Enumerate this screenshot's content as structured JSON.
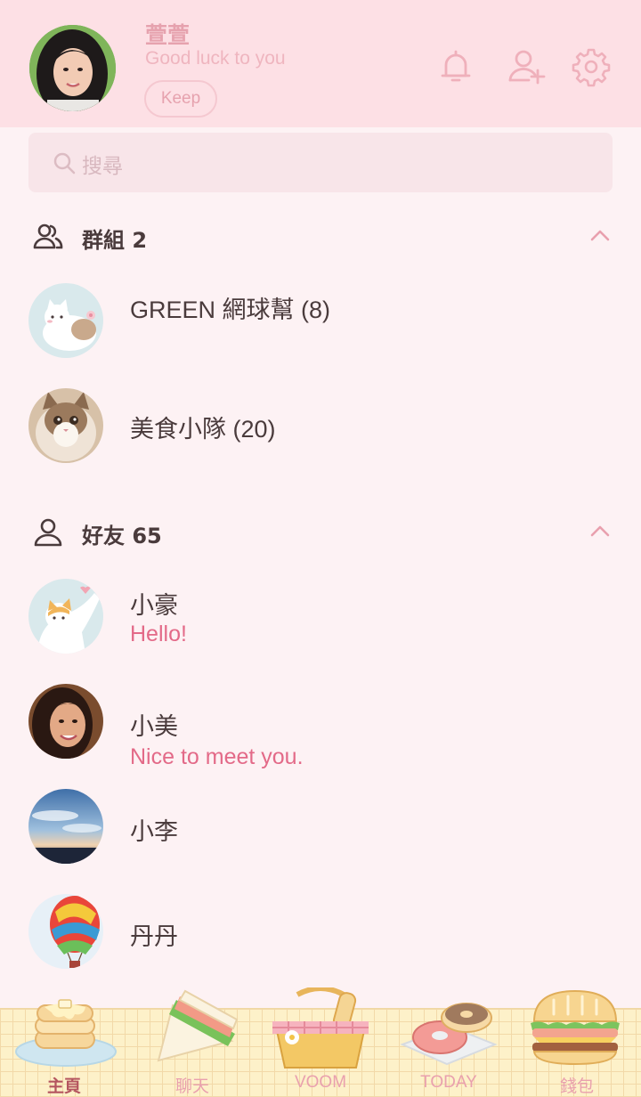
{
  "profile": {
    "name": "萱萱",
    "status": "Good luck to you",
    "keep_label": "Keep"
  },
  "header_icons": [
    "bell-icon",
    "add-friend-icon",
    "settings-gear-icon"
  ],
  "search": {
    "placeholder": "搜尋"
  },
  "groups": {
    "title": "群組 2",
    "items": [
      {
        "name": "GREEN 網球幫 (8)"
      },
      {
        "name": "美食小隊 (20)"
      }
    ]
  },
  "friends": {
    "title": "好友 65",
    "items": [
      {
        "name": "小豪",
        "message": "Hello!"
      },
      {
        "name": "小美",
        "message": "Nice to meet you."
      },
      {
        "name": "小李",
        "message": ""
      },
      {
        "name": "丹丹",
        "message": ""
      }
    ]
  },
  "tabs": [
    {
      "label": "主頁",
      "icon": "pancake-icon",
      "active": true
    },
    {
      "label": "聊天",
      "icon": "sandwich-icon",
      "active": false
    },
    {
      "label": "VOOM",
      "icon": "picnic-basket-icon",
      "active": false
    },
    {
      "label": "TODAY",
      "icon": "donut-icon",
      "active": false
    },
    {
      "label": "錢包",
      "icon": "burger-icon",
      "active": false
    }
  ],
  "colors": {
    "header_bg": "#fde0e5",
    "accent_pink": "#e36a88",
    "page_bg": "#fdf2f4",
    "tabbar_bg": "#fdf1c9"
  }
}
